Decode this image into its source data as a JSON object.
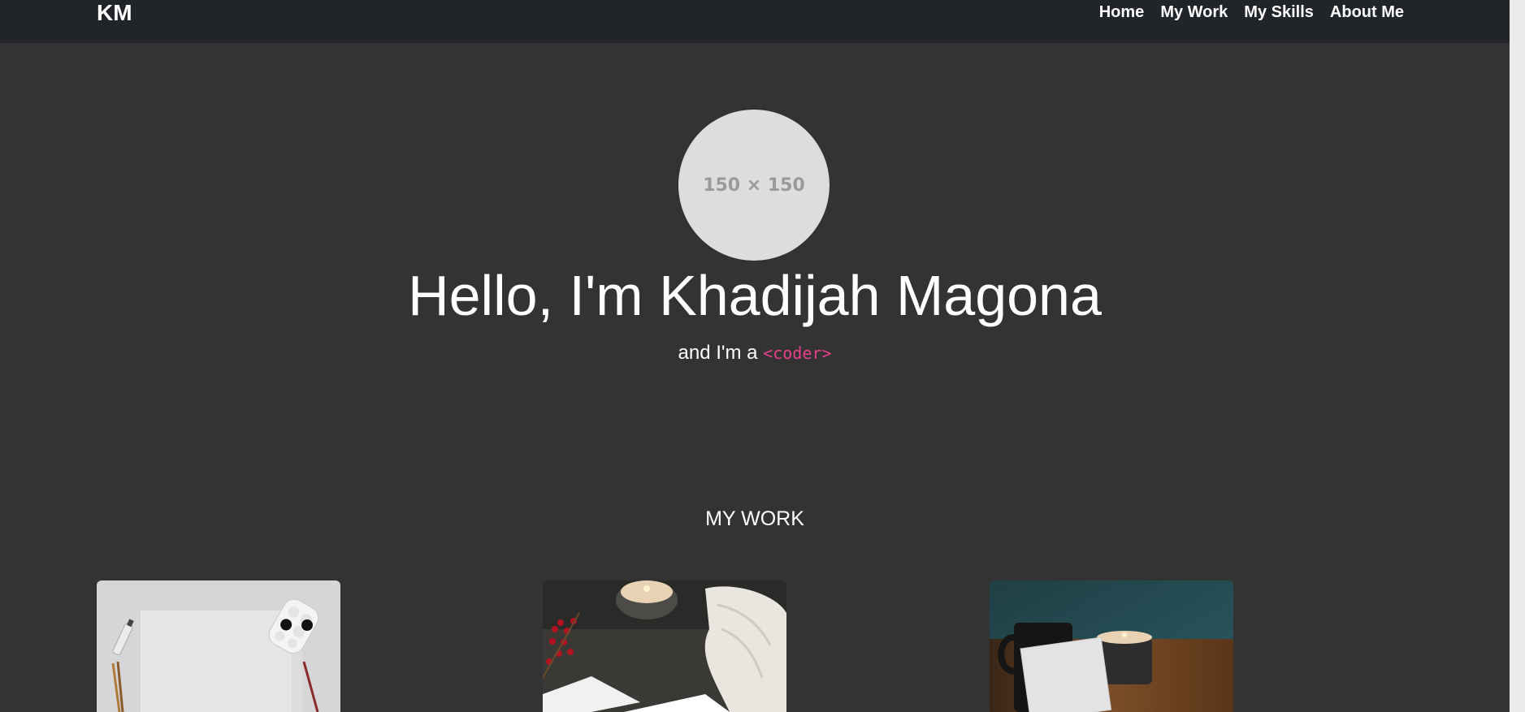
{
  "nav": {
    "brand": "KM",
    "links": [
      {
        "label": "Home"
      },
      {
        "label": "My Work"
      },
      {
        "label": "My Skills"
      },
      {
        "label": "About Me"
      }
    ]
  },
  "hero": {
    "avatar_placeholder": "150 × 150",
    "title": "Hello, I'm Khadijah Magona",
    "subtitle_prefix": "and I'm a",
    "subtitle_code": "<coder>"
  },
  "work": {
    "title": "MY WORK",
    "cards": [
      {
        "image": "blank paper with paint palette and brushes"
      },
      {
        "image": "candle, berries, knit fabric and envelope"
      },
      {
        "image": "mug, candle and blank card on wooden table"
      }
    ]
  },
  "colors": {
    "navbar_bg": "#212529",
    "page_bg": "#333333",
    "code_accent": "#e83e8c",
    "avatar_bg": "#dddddd"
  }
}
